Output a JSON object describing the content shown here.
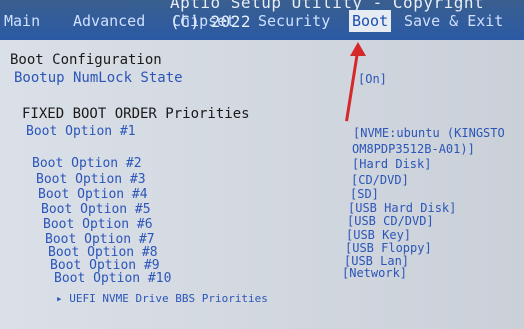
{
  "title": "Aptio Setup Utility - Copyright (C) 2022",
  "tabs": [
    "Main",
    "Advanced",
    "Chipset",
    "Security",
    "Boot",
    "Save & Exit"
  ],
  "active_tab": "Boot",
  "section": "Boot Configuration",
  "numlock": {
    "label": "Bootup NumLock State",
    "value": "[On]"
  },
  "fixed_header": "FIXED BOOT ORDER Priorities",
  "boot_options": [
    {
      "label": "Boot Option #1",
      "value": "[NVME:ubuntu (KINGSTO"
    },
    {
      "label": "",
      "value": "OM8PDP3512B-A01)]"
    },
    {
      "label": "Boot Option #2",
      "value": "[Hard Disk]"
    },
    {
      "label": "Boot Option #3",
      "value": "[CD/DVD]"
    },
    {
      "label": "Boot Option #4",
      "value": "[SD]"
    },
    {
      "label": "Boot Option #5",
      "value": "[USB Hard Disk]"
    },
    {
      "label": "Boot Option #6",
      "value": "[USB CD/DVD]"
    },
    {
      "label": "Boot Option #7",
      "value": "[USB Key]"
    },
    {
      "label": "Boot Option #8",
      "value": "[USB Floppy]"
    },
    {
      "label": "Boot Option #9",
      "value": "[USB Lan]"
    },
    {
      "label": "Boot Option #10",
      "value": "[Network]"
    }
  ],
  "uefi_link": "UEFI NVME Drive BBS Priorities",
  "colors": {
    "header_bg": "#2b5aa5",
    "panel_bg": "#d7dde6",
    "accent_blue": "#2b55b8",
    "highlight_red": "#d62828"
  }
}
